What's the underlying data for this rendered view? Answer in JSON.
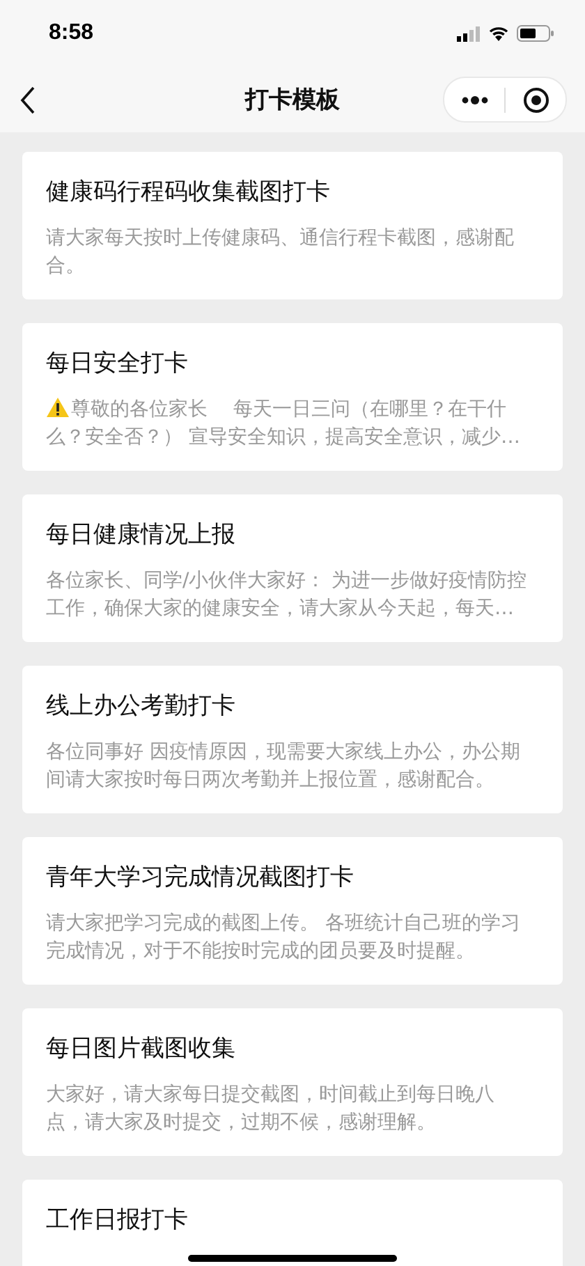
{
  "status_bar": {
    "time": "8:58"
  },
  "nav_bar": {
    "title": "打卡模板"
  },
  "templates": [
    {
      "kind": "plain",
      "title": "健康码行程码收集截图打卡",
      "description": "请大家每天按时上传健康码、通信行程卡截图，感谢配合。"
    },
    {
      "kind": "warning",
      "title": "每日安全打卡",
      "description": "尊敬的各位家长　 每天一日三问（在哪里？在干什么？安全否？） 宣导安全知识，提高安全意识，减少…"
    },
    {
      "kind": "plain",
      "title": "每日健康情况上报",
      "description": "各位家长、同学/小伙伴大家好： 为进一步做好疫情防控工作，确保大家的健康安全，请大家从今天起，每天…"
    },
    {
      "kind": "plain",
      "title": "线上办公考勤打卡",
      "description": "各位同事好 因疫情原因，现需要大家线上办公，办公期间请大家按时每日两次考勤并上报位置，感谢配合。"
    },
    {
      "kind": "plain",
      "title": "青年大学习完成情况截图打卡",
      "description": "请大家把学习完成的截图上传。 各班统计自己班的学习完成情况，对于不能按时完成的团员要及时提醒。"
    },
    {
      "kind": "plain",
      "title": "每日图片截图收集",
      "description": "大家好，请大家每日提交截图，时间截止到每日晚八点，请大家及时提交，过期不候，感谢理解。"
    },
    {
      "title": "工作日报打卡"
    }
  ]
}
